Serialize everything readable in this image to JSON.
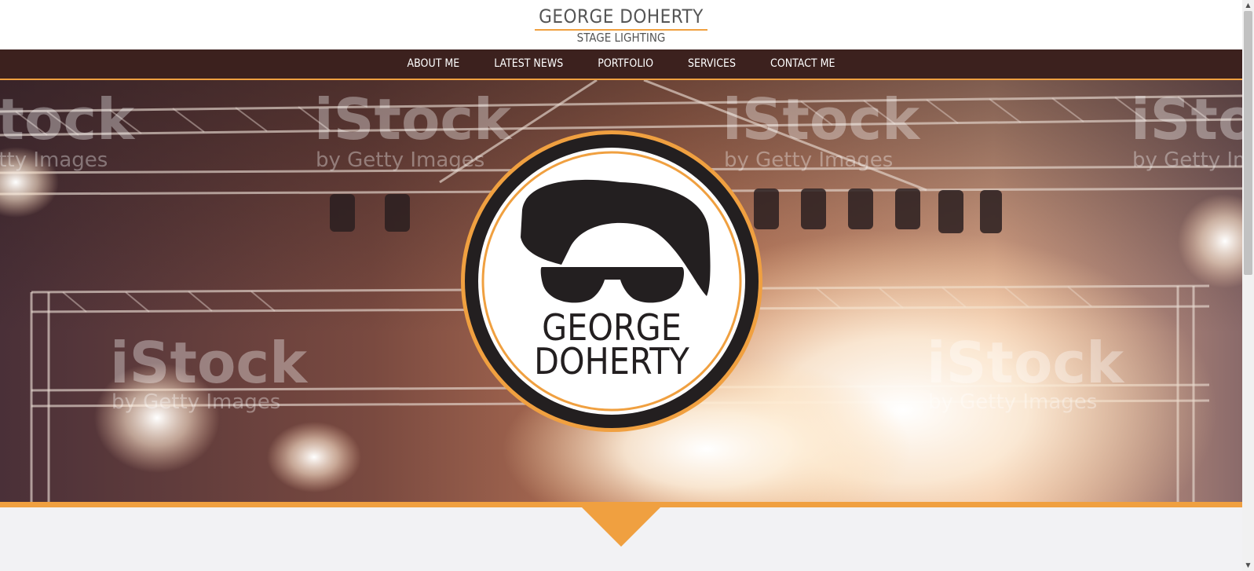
{
  "brand": {
    "title": "GEORGE DOHERTY",
    "subtitle": "STAGE LIGHTING"
  },
  "nav": {
    "items": [
      "ABOUT ME",
      "LATEST NEWS",
      "PORTFOLIO",
      "SERVICES",
      "CONTACT ME"
    ]
  },
  "hero": {
    "logo_line1": "GEORGE",
    "logo_line2": "DOHERTY",
    "watermark": {
      "brand": "iStock",
      "tagline": "by Getty Images"
    }
  },
  "icons": {
    "scroll_up": "▲",
    "scroll_down": "▼"
  },
  "colors": {
    "accent": "#f0a040",
    "nav_bg": "#3c211e",
    "text": "#555555",
    "logo_ink": "#231f20"
  }
}
